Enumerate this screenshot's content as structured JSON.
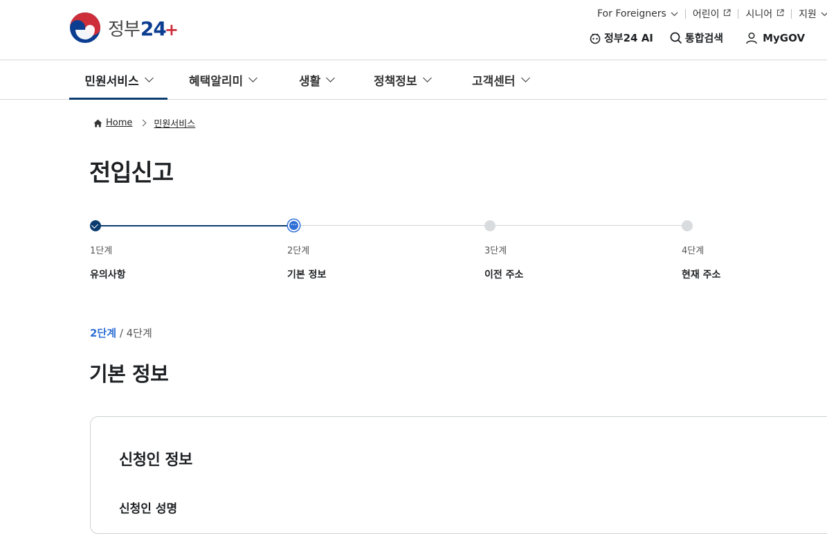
{
  "header": {
    "logo_text_ko": "정부",
    "logo_text_num": "24",
    "logo_text_plus": "+",
    "util_links": [
      {
        "label": "For Foreigners",
        "icon": "chevron-down-icon"
      },
      {
        "label": "어린이",
        "icon": "external-link-icon"
      },
      {
        "label": "시니어",
        "icon": "external-link-icon"
      },
      {
        "label": "지원",
        "icon": "chevron-down-icon"
      }
    ],
    "ai_label": "정부24 AI",
    "search_label": "통합검색",
    "mygov_label": "MyGOV"
  },
  "nav": {
    "items": [
      {
        "label": "민원서비스",
        "active": true
      },
      {
        "label": "혜택알리미",
        "active": false
      },
      {
        "label": "생활",
        "active": false
      },
      {
        "label": "정책정보",
        "active": false
      },
      {
        "label": "고객센터",
        "active": false
      }
    ]
  },
  "breadcrumb": {
    "home": "Home",
    "current": "민원서비스"
  },
  "page": {
    "title": "전입신고"
  },
  "stepper": {
    "steps": [
      {
        "num": "1단계",
        "name": "유의사항",
        "state": "done"
      },
      {
        "num": "2단계",
        "name": "기본 정보",
        "state": "current"
      },
      {
        "num": "3단계",
        "name": "이전 주소",
        "state": "todo"
      },
      {
        "num": "4단계",
        "name": "현재 주소",
        "state": "todo"
      }
    ]
  },
  "section": {
    "step_current": "2단계",
    "step_sep": " / ",
    "step_total": "4단계",
    "title": "기본 정보"
  },
  "card": {
    "title": "신청인 정보",
    "field_label": "신청인 성명"
  },
  "colors": {
    "primary_navy": "#0b3b6e",
    "accent_blue": "#2f6fd6",
    "logo_red": "#cd2e3a"
  }
}
